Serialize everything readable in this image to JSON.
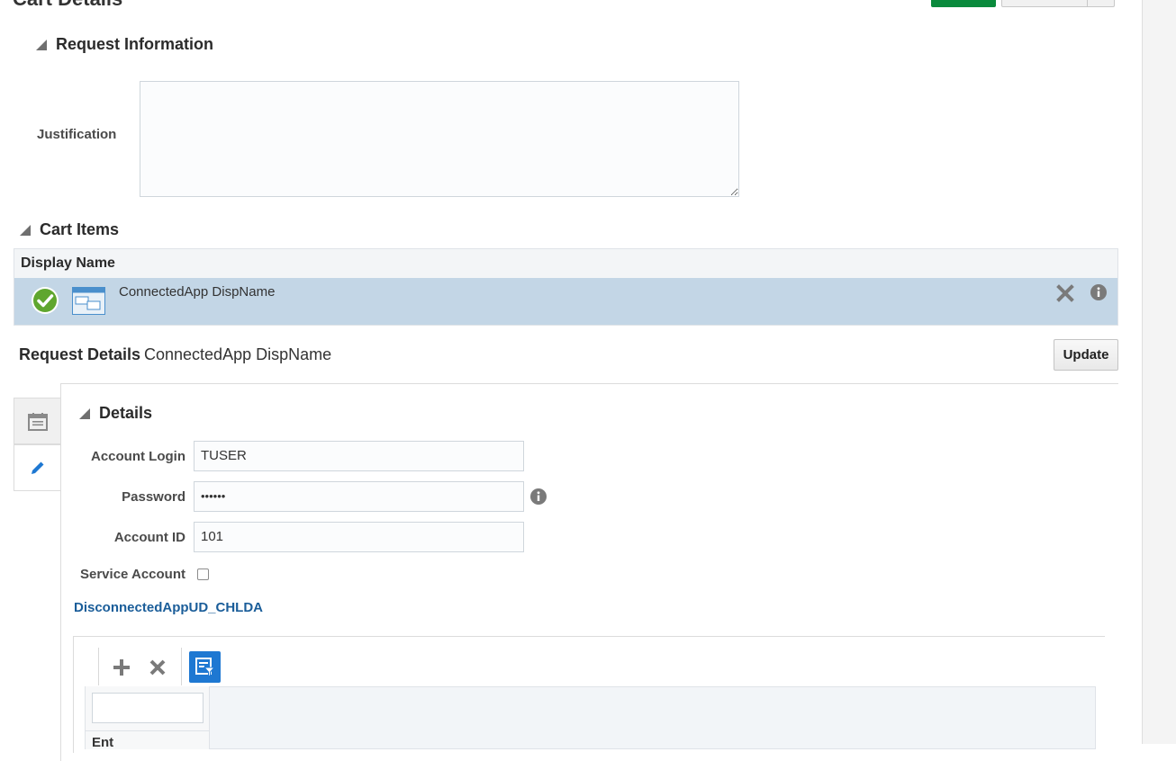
{
  "page": {
    "title": "Cart Details"
  },
  "request_information": {
    "header": "Request Information",
    "justification_label": "Justification",
    "justification_value": ""
  },
  "cart_items": {
    "header": "Cart Items",
    "column_header": "Display Name",
    "rows": [
      {
        "display_name": "ConnectedApp DispName",
        "status": "check-icon",
        "type_icon": "application-icon"
      }
    ]
  },
  "request_details": {
    "label": "Request Details",
    "value": "ConnectedApp DispName",
    "update_label": "Update"
  },
  "details": {
    "header": "Details",
    "account_login_label": "Account Login",
    "account_login_value": "TUSER",
    "password_label": "Password",
    "password_value": "••••••",
    "account_id_label": "Account ID",
    "account_id_value": "101",
    "service_account_label": "Service Account",
    "service_account_checked": false,
    "child_form_link": "DisconnectedAppUD_CHLDA"
  },
  "child_table": {
    "toolbar": [
      "add-icon",
      "remove-icon",
      "filter-icon"
    ],
    "column_header_partial": "Ent"
  },
  "colors": {
    "accent_green": "#0a8a3c",
    "selected_row": "#c3d6e6",
    "link_blue": "#1a5d99",
    "filter_button": "#1e78d2"
  }
}
